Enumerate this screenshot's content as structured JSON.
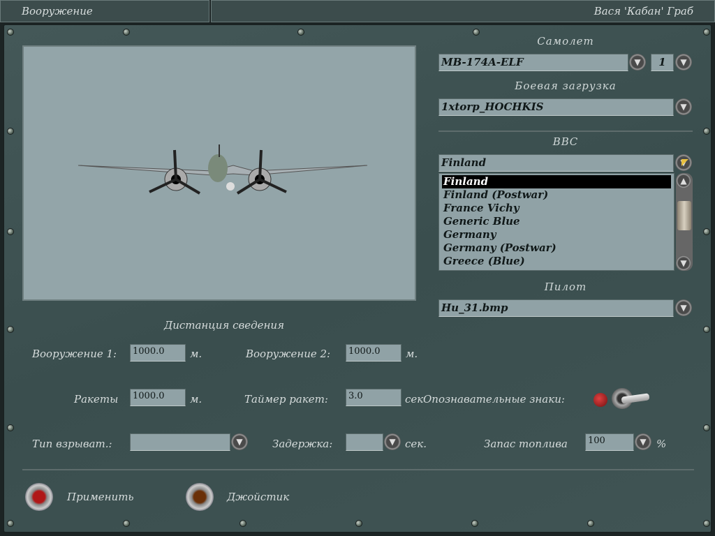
{
  "title_bar": {
    "left": "Вооружение",
    "right": "Вася 'Кабан' Граб"
  },
  "aircraft": {
    "header": "Самолет",
    "value": "MB-174A-ELF",
    "count": "1"
  },
  "loadout": {
    "header": "Боевая загрузка",
    "value": "1xtorp_HOCHKIS"
  },
  "air_force": {
    "header": "ВВС",
    "value": "Finland",
    "options": [
      "Finland",
      "Finland (Postwar)",
      "France Vichy",
      "Generic Blue",
      "Germany",
      "Germany (Postwar)",
      "Greece (Blue)"
    ],
    "selected_index": 0
  },
  "pilot": {
    "header": "Пилот",
    "value": "Hu_31.bmp"
  },
  "convergence": {
    "header": "Дистанция сведения",
    "weapon1_label": "Вооружение 1:",
    "weapon1_value": "1000.0",
    "weapon1_unit": "м.",
    "weapon2_label": "Вооружение 2:",
    "weapon2_value": "1000.0",
    "weapon2_unit": "м.",
    "rockets_label": "Ракеты",
    "rockets_value": "1000.0",
    "rockets_unit": "м.",
    "rocket_timer_label": "Таймер ракет:",
    "rocket_timer_value": "3.0",
    "rocket_timer_unit": "сек",
    "markings_label": "Опознавательные знаки:",
    "fuze_label": "Тип взрыват.:",
    "fuze_value": "",
    "delay_label": "Задержка:",
    "delay_value": "",
    "delay_unit": "сек.",
    "fuel_label": "Запас топлива",
    "fuel_value": "100",
    "fuel_unit": "%"
  },
  "buttons": {
    "apply": "Применить",
    "joystick": "Джойстик"
  }
}
